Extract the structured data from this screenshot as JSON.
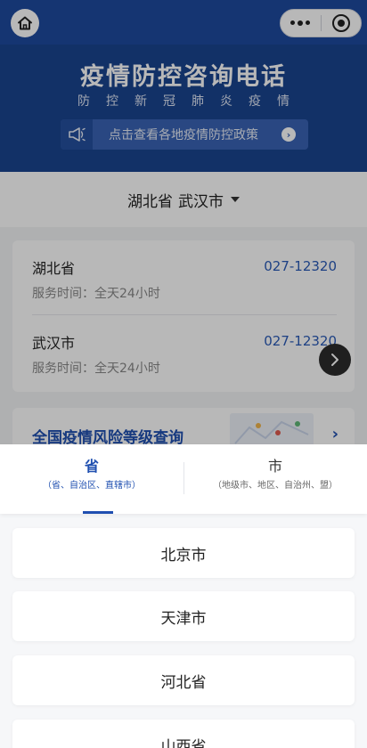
{
  "banner": {
    "title": "疫情防控咨询电话",
    "subtitle": "防控新冠肺炎疫情",
    "policy_button": "点击查看各地疫情防控政策"
  },
  "location": {
    "province": "湖北省",
    "city": "武汉市"
  },
  "hotlines": [
    {
      "name": "湖北省",
      "phone": "027-12320",
      "hours": "服务时间：全天24小时"
    },
    {
      "name": "武汉市",
      "phone": "027-12320",
      "hours": "服务时间：全天24小时"
    }
  ],
  "risk_card": {
    "title": "全国疫情风险等级查询"
  },
  "picker": {
    "tabs": [
      {
        "label": "省",
        "hint": "（省、自治区、直辖市）",
        "active": true
      },
      {
        "label": "市",
        "hint": "（地级市、地区、自治州、盟）",
        "active": false
      }
    ],
    "options": [
      "北京市",
      "天津市",
      "河北省",
      "山西省"
    ]
  },
  "colors": {
    "brand_blue": "#1e4a9e",
    "accent_blue": "#1f4fb0",
    "phone_blue": "#2a5bb8"
  },
  "icons": {
    "home": "home-icon",
    "more": "more-dots-icon",
    "close": "target-close-icon",
    "megaphone": "megaphone-icon",
    "next": "chevron-right-icon"
  }
}
